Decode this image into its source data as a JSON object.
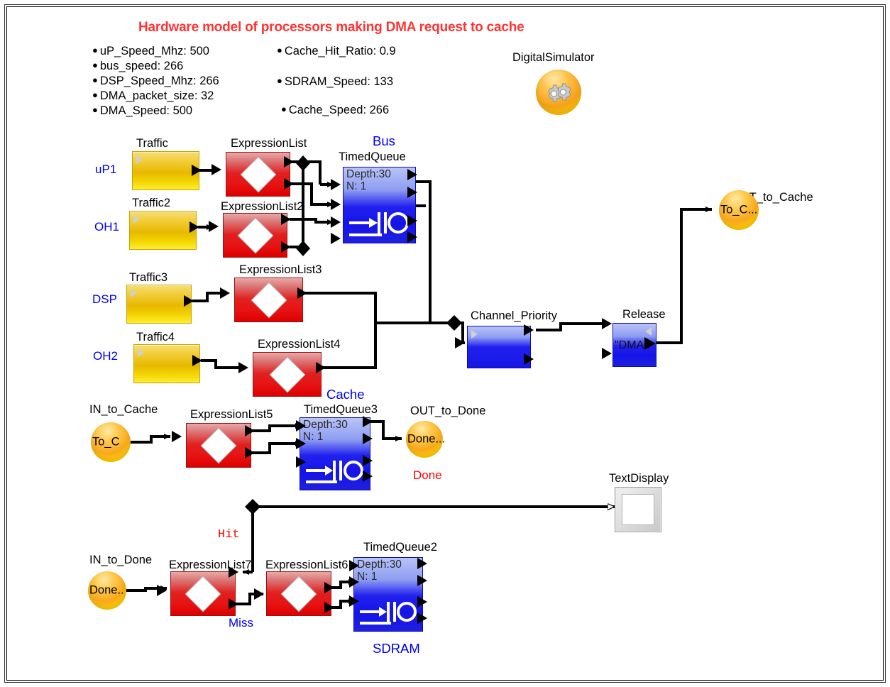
{
  "title": "Hardware model of processors making DMA request to cache",
  "parameters_left": [
    "uP_Speed_Mhz: 500",
    "bus_speed: 266",
    "DSP_Speed_Mhz: 266",
    "DMA_packet_size: 32",
    "DMA_Speed: 500"
  ],
  "parameters_right": [
    "Cache_Hit_Ratio: 0.9",
    "SDRAM_Speed: 133",
    "Cache_Speed: 266"
  ],
  "simulator": {
    "label": "DigitalSimulator",
    "icon": "gears-icon"
  },
  "sources": [
    {
      "role": "uP1",
      "block": "Traffic"
    },
    {
      "role": "OH1",
      "block": "Traffic2"
    },
    {
      "role": "DSP",
      "block": "Traffic3"
    },
    {
      "role": "OH2",
      "block": "Traffic4"
    }
  ],
  "expressions": [
    "ExpressionList",
    "ExpressionList2",
    "ExpressionList3",
    "ExpressionList4",
    "ExpressionList5",
    "ExpressionList7",
    "ExpressionList6"
  ],
  "queues": [
    {
      "group": "Bus",
      "name": "TimedQueue",
      "depth": "Depth:30",
      "n": "N: 1"
    },
    {
      "group": "Cache",
      "name": "TimedQueue3",
      "depth": "Depth:30",
      "n": "N: 1"
    },
    {
      "group": "SDRAM",
      "name": "TimedQueue2",
      "depth": "Depth:30",
      "n": "N: 1"
    }
  ],
  "channel_priority": {
    "label": "Channel_Priority"
  },
  "release": {
    "label": "Release",
    "value": "\"DMA.."
  },
  "terminals": {
    "out_to_cache": {
      "label": "OUT_to_Cache",
      "value": "To_C..."
    },
    "in_to_cache": {
      "label": "IN_to_Cache",
      "value": "To_C"
    },
    "out_to_done": {
      "label": "OUT_to_Done",
      "value": "Done...",
      "sub": "Done"
    },
    "in_to_done": {
      "label": "IN_to_Done",
      "value": "Done.."
    }
  },
  "signal_labels": {
    "hit": "Hit",
    "miss": "Miss"
  },
  "text_display": {
    "label": "TextDisplay"
  },
  "colors": {
    "title_red": "#ff3333",
    "label_blue": "#0000ee",
    "source_yellow": "#f2cf3d",
    "expression_red": "#e02020",
    "queue_blue": "#2222ee",
    "terminal_orange": "#ffc94a"
  }
}
